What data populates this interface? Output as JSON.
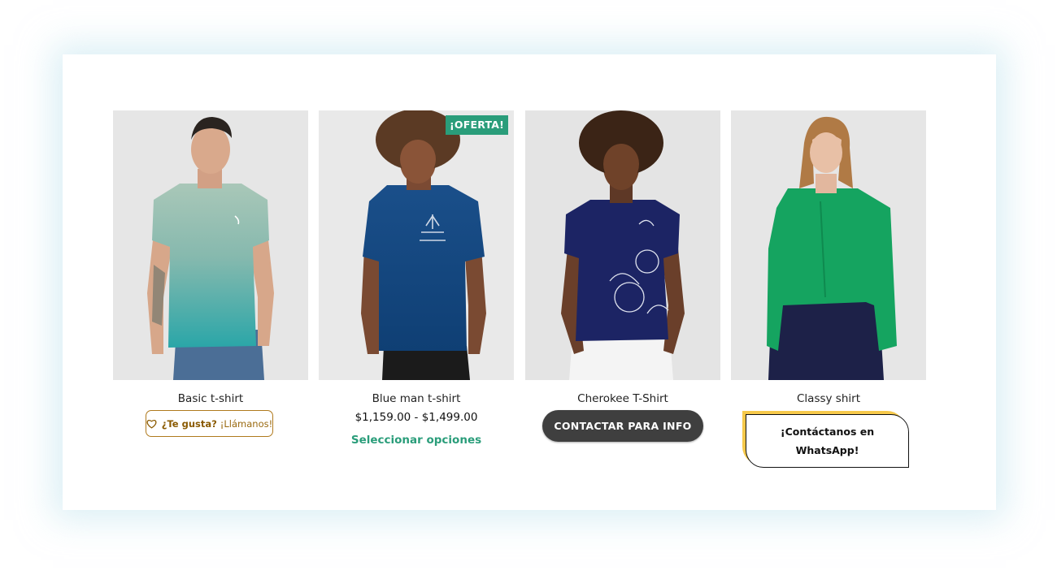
{
  "colors": {
    "accent_green": "#2a9d7a",
    "like_border": "#b07a1d",
    "contact_bg": "#3f3f3f",
    "whatsapp_accent": "#f6c94b",
    "card_glow": "#bee2ec"
  },
  "products": [
    {
      "name": "Basic t-shirt",
      "image_desc": "man-green-gradient-tshirt",
      "action": {
        "type": "like-button",
        "icon": "heart-outline-icon",
        "strong": "¿Te gusta?",
        "light": "¡Llámanos!"
      }
    },
    {
      "name": "Blue man t-shirt",
      "image_desc": "man-blue-adidas-tshirt",
      "badge": "¡OFERTA!",
      "price": "$1,159.00 - $1,499.00",
      "action": {
        "type": "link",
        "label": "Seleccionar opciones"
      }
    },
    {
      "name": "Cherokee T-Shirt",
      "image_desc": "woman-navy-floral-tshirt",
      "action": {
        "type": "pill-button",
        "label": "CONTACTAR PARA INFO"
      }
    },
    {
      "name": "Classy shirt",
      "image_desc": "woman-green-blouse",
      "action": {
        "type": "whatsapp-button",
        "label": "¡Contáctanos en WhatsApp!"
      }
    }
  ]
}
